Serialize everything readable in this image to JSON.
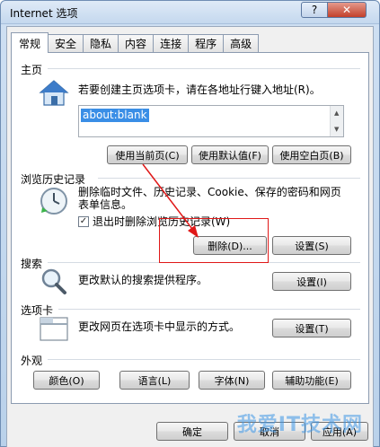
{
  "window": {
    "title": "Internet 选项",
    "help_label": "?",
    "close_label": "✕"
  },
  "tabs": [
    "常规",
    "安全",
    "隐私",
    "内容",
    "连接",
    "程序",
    "高级"
  ],
  "homepage": {
    "section_title": "主页",
    "description": "若要创建主页选项卡，请在各地址行键入地址(R)。",
    "address": "about:blank",
    "buttons": [
      "使用当前页(C)",
      "使用默认值(F)",
      "使用空白页(B)"
    ]
  },
  "history": {
    "section_title": "浏览历史记录",
    "description_line1": "删除临时文件、历史记录、Cookie、保存的密码和网页",
    "description_line2": "表单信息。",
    "checkbox_label": "退出时删除浏览历史记录(W)",
    "checkbox_checked": true,
    "delete_button": "删除(D)...",
    "settings_button": "设置(S)"
  },
  "search": {
    "section_title": "搜索",
    "description": "更改默认的搜索提供程序。",
    "settings_button": "设置(I)"
  },
  "tabs_section": {
    "section_title": "选项卡",
    "description": "更改网页在选项卡中显示的方式。",
    "settings_button": "设置(T)"
  },
  "appearance": {
    "section_title": "外观",
    "buttons": [
      "颜色(O)",
      "语言(L)",
      "字体(N)",
      "辅助功能(E)"
    ]
  },
  "footer": {
    "ok_button": "确定",
    "cancel_button": "取消",
    "apply_button": "应用(A)"
  },
  "watermark": "我爱IT技术网",
  "colors": {
    "highlight_box": "#e01818",
    "selection": "#3a8ee6"
  }
}
